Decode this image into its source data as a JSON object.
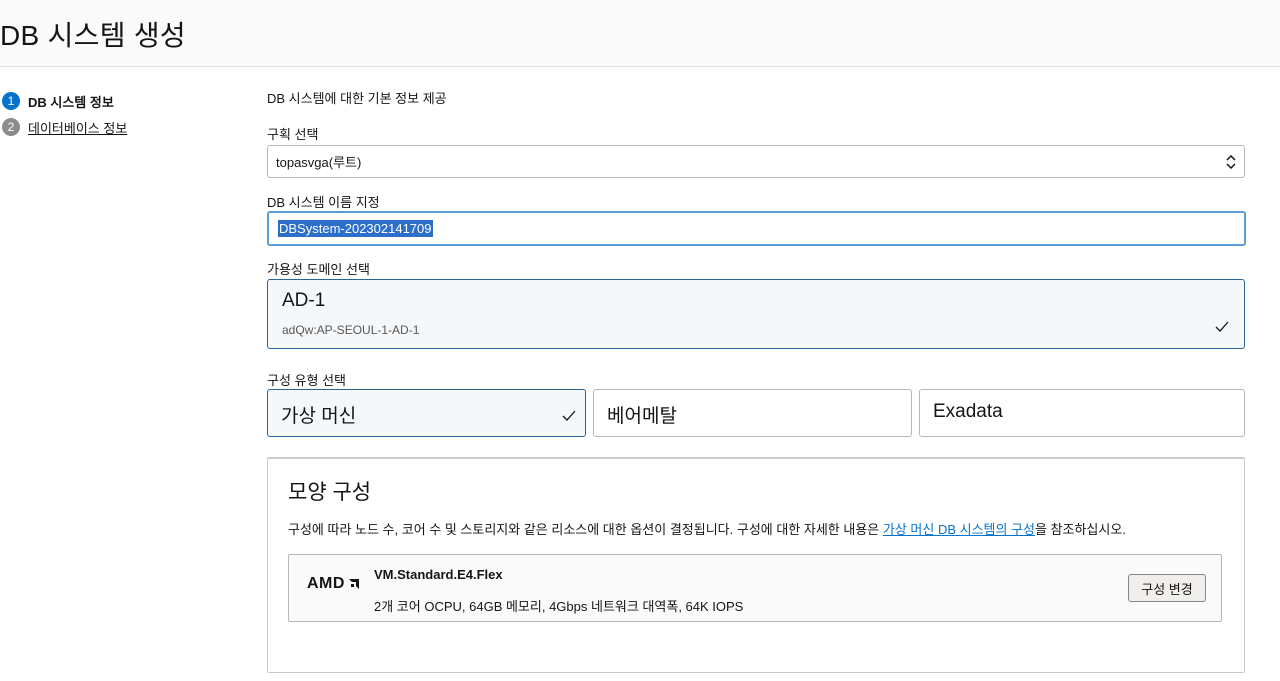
{
  "header": {
    "title": "DB 시스템 생성"
  },
  "steps": [
    {
      "num": "1",
      "label": "DB 시스템 정보"
    },
    {
      "num": "2",
      "label": "데이터베이스 정보"
    }
  ],
  "form": {
    "intro": "DB 시스템에 대한 기본 정보 제공",
    "compartment": {
      "label": "구획 선택",
      "value": "topasvga(루트)"
    },
    "name": {
      "label": "DB 시스템 이름 지정",
      "value": "DBSystem-202302141709"
    },
    "availability_domain": {
      "label": "가용성 도메인 선택",
      "title": "AD-1",
      "subtitle": "adQw:AP-SEOUL-1-AD-1"
    },
    "config_type": {
      "label": "구성 유형 선택",
      "options": [
        "가상 머신",
        "베어메탈",
        "Exadata"
      ],
      "selected": "가상 머신"
    }
  },
  "shape": {
    "title": "모양 구성",
    "desc_before": "구성에 따라 노드 수, 코어 수 및 스토리지와 같은 리소스에 대한 옵션이 결정됩니다. 구성에 대한 자세한 내용은 ",
    "desc_link": "가상 머신 DB 시스템의 구성",
    "desc_after": "을 참조하십시오.",
    "vendor": "AMD",
    "name": "VM.Standard.E4.Flex",
    "spec": "2개 코어 OCPU, 64GB 메모리, 4Gbps 네트워크 대역폭, 64K IOPS",
    "change_button": "구성 변경"
  },
  "icons": {
    "check": "check-icon",
    "select_arrows": "chevron-up-down-icon",
    "amd_logo": "amd-logo-icon"
  },
  "colors": {
    "accent": "#0572ce",
    "selected_border": "#2b6598",
    "selected_bg": "#f5f8fb"
  }
}
